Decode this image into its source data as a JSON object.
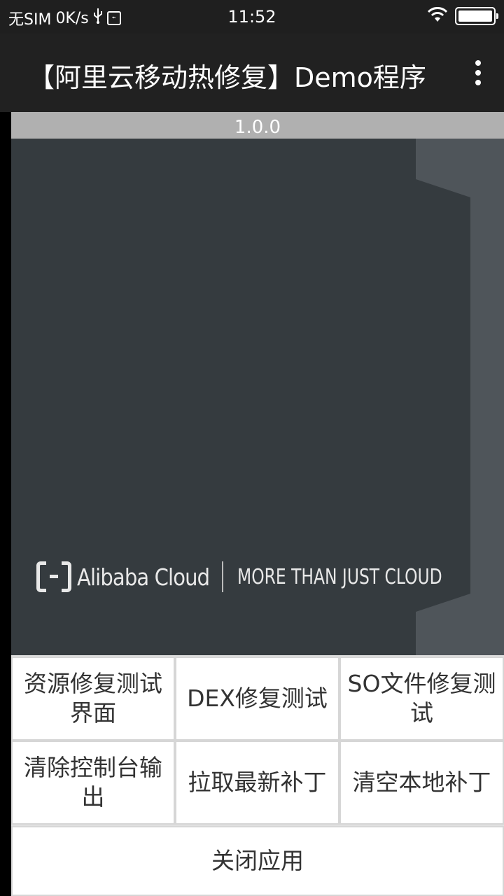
{
  "status_bar": {
    "carrier": "无SIM",
    "speed": "0K/s",
    "time": "11:52"
  },
  "app_bar": {
    "title": "【阿里云移动热修复】Demo程序"
  },
  "version": "1.0.0",
  "banner": {
    "brand": "Alibaba Cloud",
    "slogan": "MORE THAN JUST CLOUD"
  },
  "buttons": {
    "resource_fix": "资源修复测试界面",
    "dex_fix": "DEX修复测试",
    "so_fix": "SO文件修复测试",
    "clear_console": "清除控制台输出",
    "pull_patch": "拉取最新补丁",
    "clear_patch": "清空本地补丁",
    "close_app": "关闭应用"
  },
  "colors": {
    "app_bar": "#212121",
    "banner": "#353b3f",
    "version_bar": "#b0b0b0"
  }
}
